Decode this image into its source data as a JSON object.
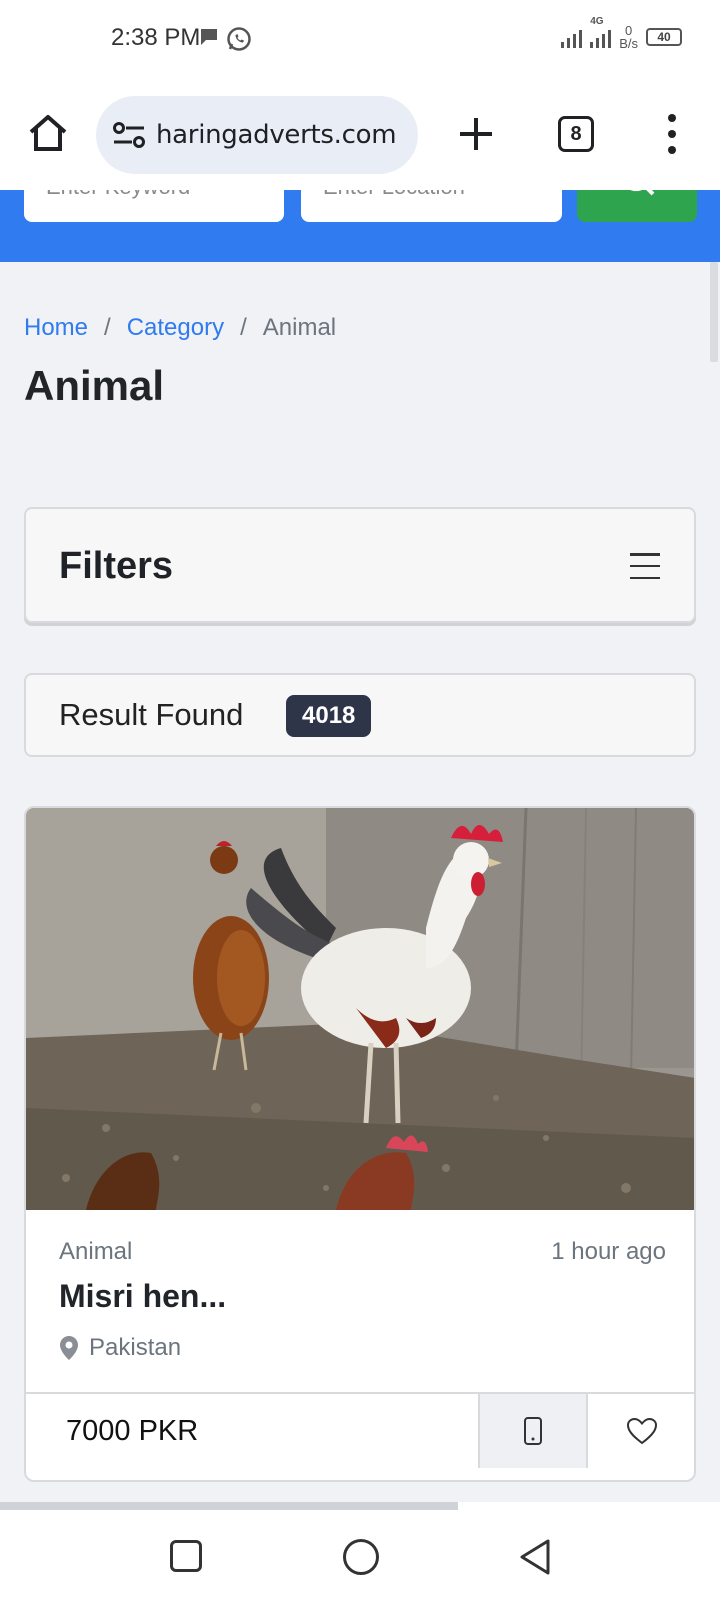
{
  "status_bar": {
    "time": "2:38 PM",
    "network_type": "4G",
    "speed_value": "0",
    "speed_unit": "B/s",
    "battery": "40"
  },
  "browser": {
    "url": "haringadverts.com",
    "tab_count": "8"
  },
  "search": {
    "keyword_placeholder": "Enter Keyword",
    "location_placeholder": "Enter Location"
  },
  "breadcrumb": {
    "home": "Home",
    "separator": "/",
    "category": "Category",
    "current": "Animal"
  },
  "page": {
    "title": "Animal"
  },
  "filters": {
    "title": "Filters"
  },
  "results": {
    "label": "Result Found",
    "count": "4018"
  },
  "listing": {
    "category": "Animal",
    "posted": "1 hour ago",
    "title": "Misri hen...",
    "location": "Pakistan",
    "price": "7000 PKR"
  },
  "colors": {
    "brand_blue": "#2f7bef",
    "search_green": "#2ea44f",
    "badge_dark": "#2f3549"
  },
  "icons": {
    "home": "home-icon",
    "site_settings": "tune-icon",
    "new_tab": "plus-icon",
    "menu": "more-vert-icon",
    "search": "search-icon",
    "filters_toggle": "hamburger-icon",
    "location": "map-pin-icon",
    "call": "mobile-phone-icon",
    "favorite": "heart-icon"
  }
}
